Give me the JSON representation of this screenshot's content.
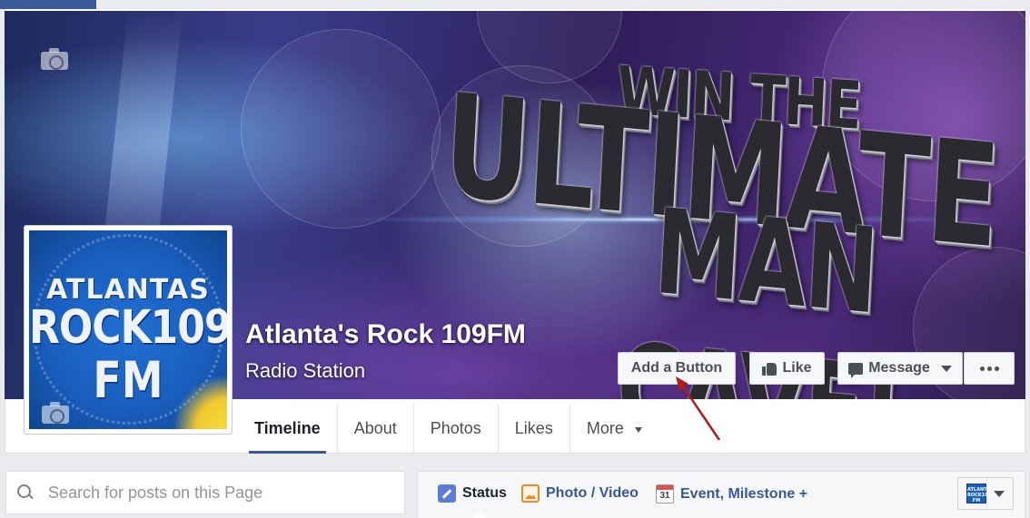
{
  "page": {
    "name": "Atlanta's Rock 109FM",
    "category": "Radio Station"
  },
  "cover": {
    "promo_line1": "WIN THE",
    "promo_line2": "ULTIMATE",
    "promo_line3": "MAN CAVE!",
    "camera_icon": "camera-icon"
  },
  "profile": {
    "logo_line1": "ATLANTAS",
    "logo_line2": "ROCK109",
    "logo_line3": "FM",
    "camera_icon": "camera-icon"
  },
  "actions": {
    "add_button": "Add a Button",
    "like": "Like",
    "message": "Message",
    "more_icon": "ellipsis-icon"
  },
  "nav": {
    "tabs": [
      {
        "label": "Timeline",
        "active": true
      },
      {
        "label": "About"
      },
      {
        "label": "Photos"
      },
      {
        "label": "Likes"
      },
      {
        "label": "More"
      }
    ]
  },
  "search": {
    "placeholder": "Search for posts on this Page",
    "value": ""
  },
  "composer": {
    "status": "Status",
    "photo_video": "Photo / Video",
    "event_milestone": "Event, Milestone +",
    "calendar_day": "31",
    "avatar_text": "ATLANTAS ROCK109 FM"
  },
  "colors": {
    "brand": "#3b5998",
    "link": "#365899",
    "annotation_arrow": "#b01c1c"
  }
}
